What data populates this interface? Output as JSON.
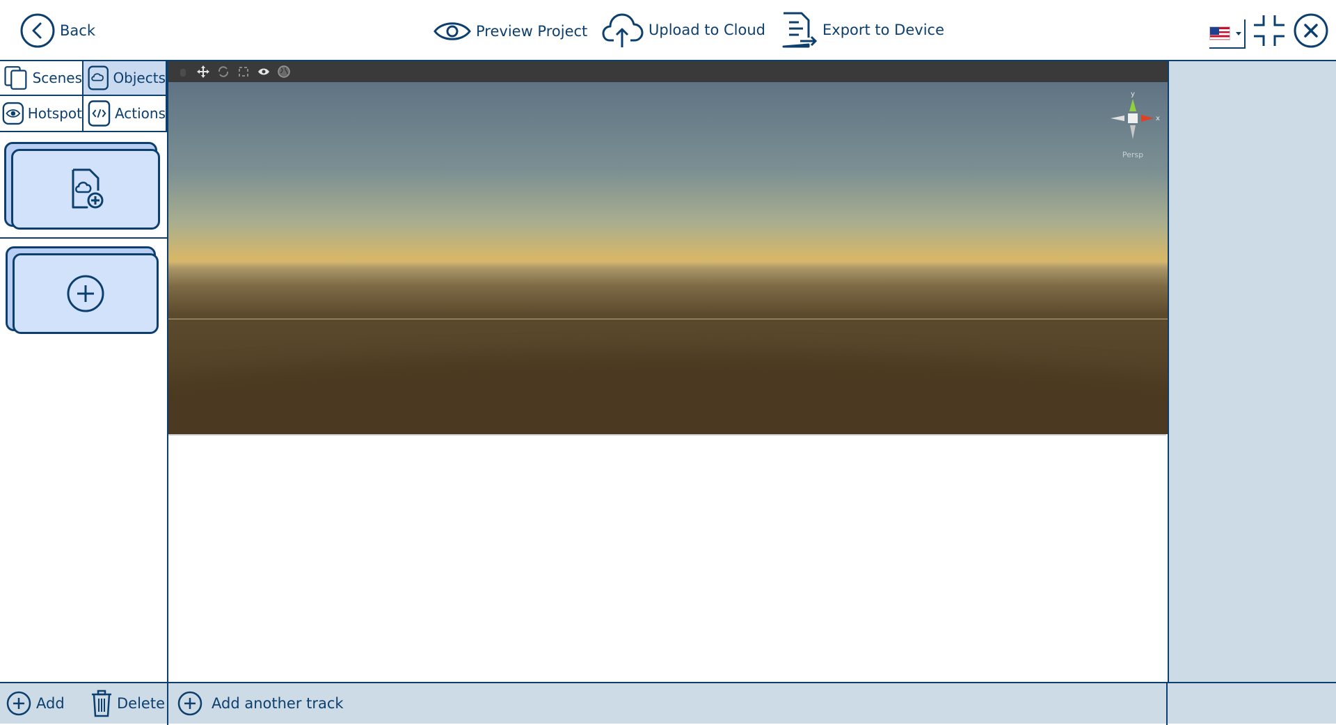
{
  "topbar": {
    "back_label": "Back",
    "preview_label": "Preview Project",
    "upload_label": "Upload to Cloud",
    "export_label": "Export to Device",
    "language_flag": "us-flag-icon"
  },
  "sidebar": {
    "tabs": [
      {
        "label": "Scenes",
        "icon": "scenes-icon",
        "active": false
      },
      {
        "label": "Objects",
        "icon": "object-icon",
        "active": true
      },
      {
        "label": "Hotspot",
        "icon": "eye-icon",
        "active": false
      },
      {
        "label": "Actions",
        "icon": "code-icon",
        "active": false
      }
    ],
    "cards": [
      {
        "icon": "add-object-file-icon"
      },
      {
        "icon": "add-circle-icon"
      }
    ]
  },
  "viewport": {
    "gizmo_label": "Persp",
    "axis_y": "y",
    "axis_x": "x"
  },
  "bottombar": {
    "add_label": "Add",
    "delete_label": "Delete",
    "add_track_label": "Add another track"
  },
  "colors": {
    "primary": "#0d3f6e",
    "panel": "#cddbe6",
    "active_tab": "#c9daf0",
    "card_fill": "#d3e2fb"
  }
}
